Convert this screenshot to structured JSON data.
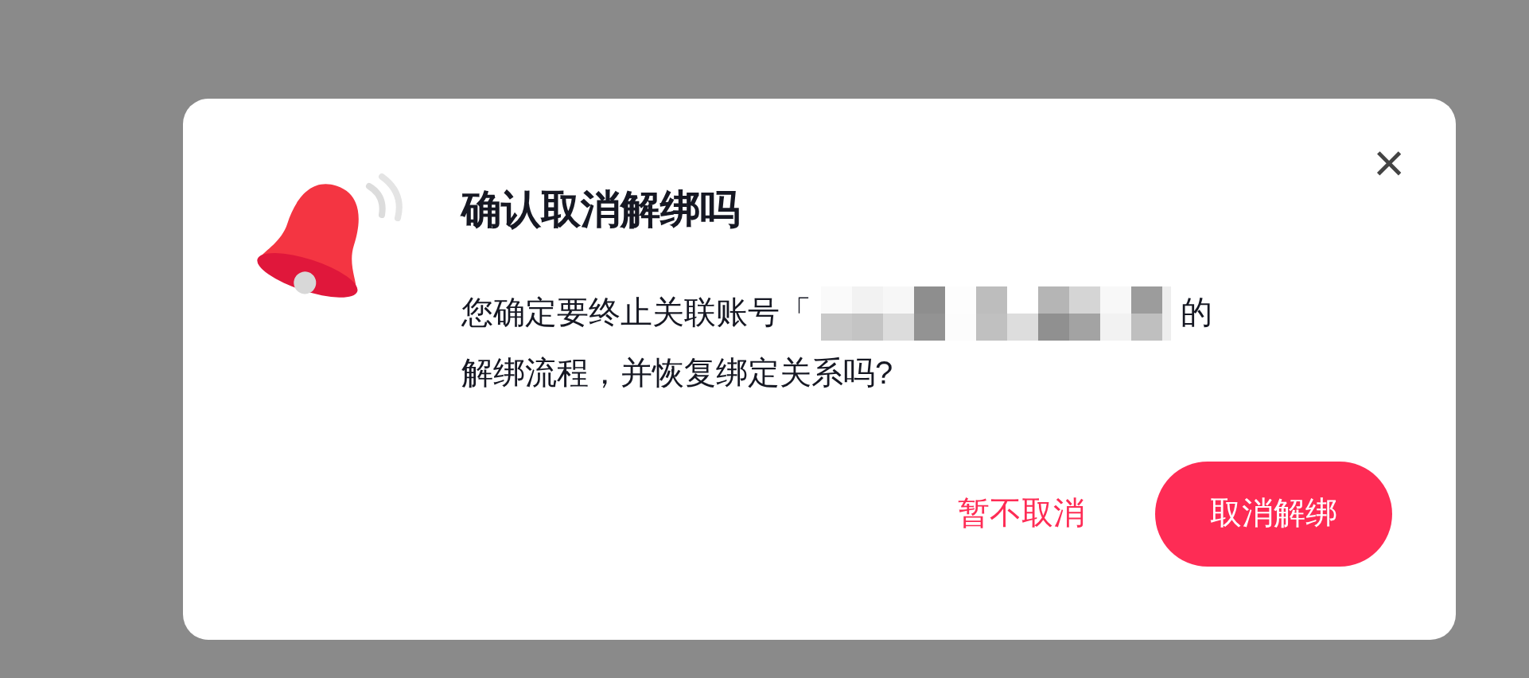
{
  "dialog": {
    "title": "确认取消解绑吗",
    "message_before": "您确定要终止关联账号「",
    "message_after": "的",
    "message_line2": "解绑流程，并恢复绑定关系吗?",
    "close_label": "×",
    "buttons": [
      {
        "label": "暂不取消",
        "kind": "text"
      },
      {
        "label": "取消解绑",
        "kind": "primary"
      }
    ]
  }
}
